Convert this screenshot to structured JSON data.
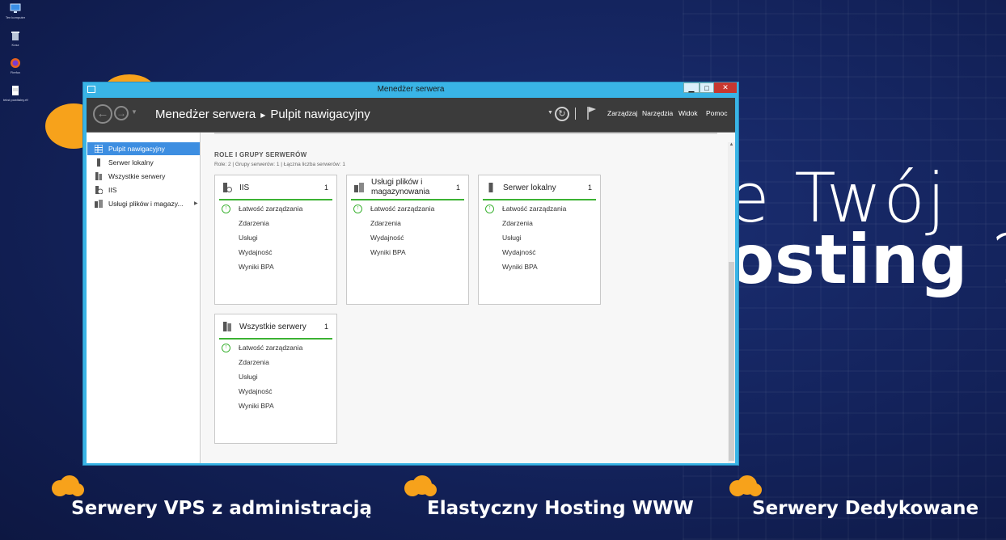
{
  "desktop": {
    "icons": [
      {
        "name": "Ten komputer",
        "icon": "computer-icon"
      },
      {
        "name": "Kosz",
        "icon": "recycle-bin-icon"
      },
      {
        "name": "Firefox",
        "icon": "firefox-icon"
      },
      {
        "name": "tekst powitalny.rtf",
        "icon": "document-icon"
      }
    ]
  },
  "promo": {
    "line1": "e Twój",
    "line2": "osting",
    "line2_suffix": "?",
    "bottom": [
      "Serwery VPS z administracją",
      "Elastyczny Hosting WWW",
      "Serwery Dedykowane"
    ],
    "accent_color": "#f7a21b"
  },
  "window": {
    "title": "Menedżer serwera",
    "controls": {
      "minimize": "▁",
      "maximize": "□",
      "close": "✕"
    },
    "breadcrumb": {
      "root": "Menedżer serwera",
      "current": "Pulpit nawigacyjny"
    },
    "menu": [
      "Zarządzaj",
      "Narzędzia",
      "Widok",
      "Pomoc"
    ]
  },
  "sidebar": {
    "items": [
      {
        "label": "Pulpit nawigacyjny",
        "icon": "dashboard-icon",
        "active": true
      },
      {
        "label": "Serwer lokalny",
        "icon": "server-icon"
      },
      {
        "label": "Wszystkie serwery",
        "icon": "servers-icon"
      },
      {
        "label": "IIS",
        "icon": "iis-icon"
      },
      {
        "label": "Usługi plików i magazy...",
        "icon": "file-services-icon",
        "has_arrow": true
      }
    ]
  },
  "main": {
    "section_title": "ROLE I GRUPY SERWERÓW",
    "section_sub": "Role: 2 | Grupy serwerów: 1 | Łączna liczba serwerów: 1",
    "tiles": [
      {
        "name": "IIS",
        "count": "1",
        "icon": "iis-icon",
        "rows": [
          "Łatwość zarządzania",
          "Zdarzenia",
          "Usługi",
          "Wydajność",
          "Wyniki BPA"
        ]
      },
      {
        "name": "Usługi plików i magazynowania",
        "count": "1",
        "icon": "file-services-icon",
        "rows": [
          "Łatwość zarządzania",
          "Zdarzenia",
          "Wydajność",
          "Wyniki BPA"
        ]
      },
      {
        "name": "Serwer lokalny",
        "count": "1",
        "icon": "server-icon",
        "rows": [
          "Łatwość zarządzania",
          "Zdarzenia",
          "Usługi",
          "Wydajność",
          "Wyniki BPA"
        ]
      },
      {
        "name": "Wszystkie serwery",
        "count": "1",
        "icon": "servers-icon",
        "rows": [
          "Łatwość zarządzania",
          "Zdarzenia",
          "Usługi",
          "Wydajność",
          "Wyniki BPA"
        ]
      }
    ],
    "status_color": "#3cb233"
  }
}
